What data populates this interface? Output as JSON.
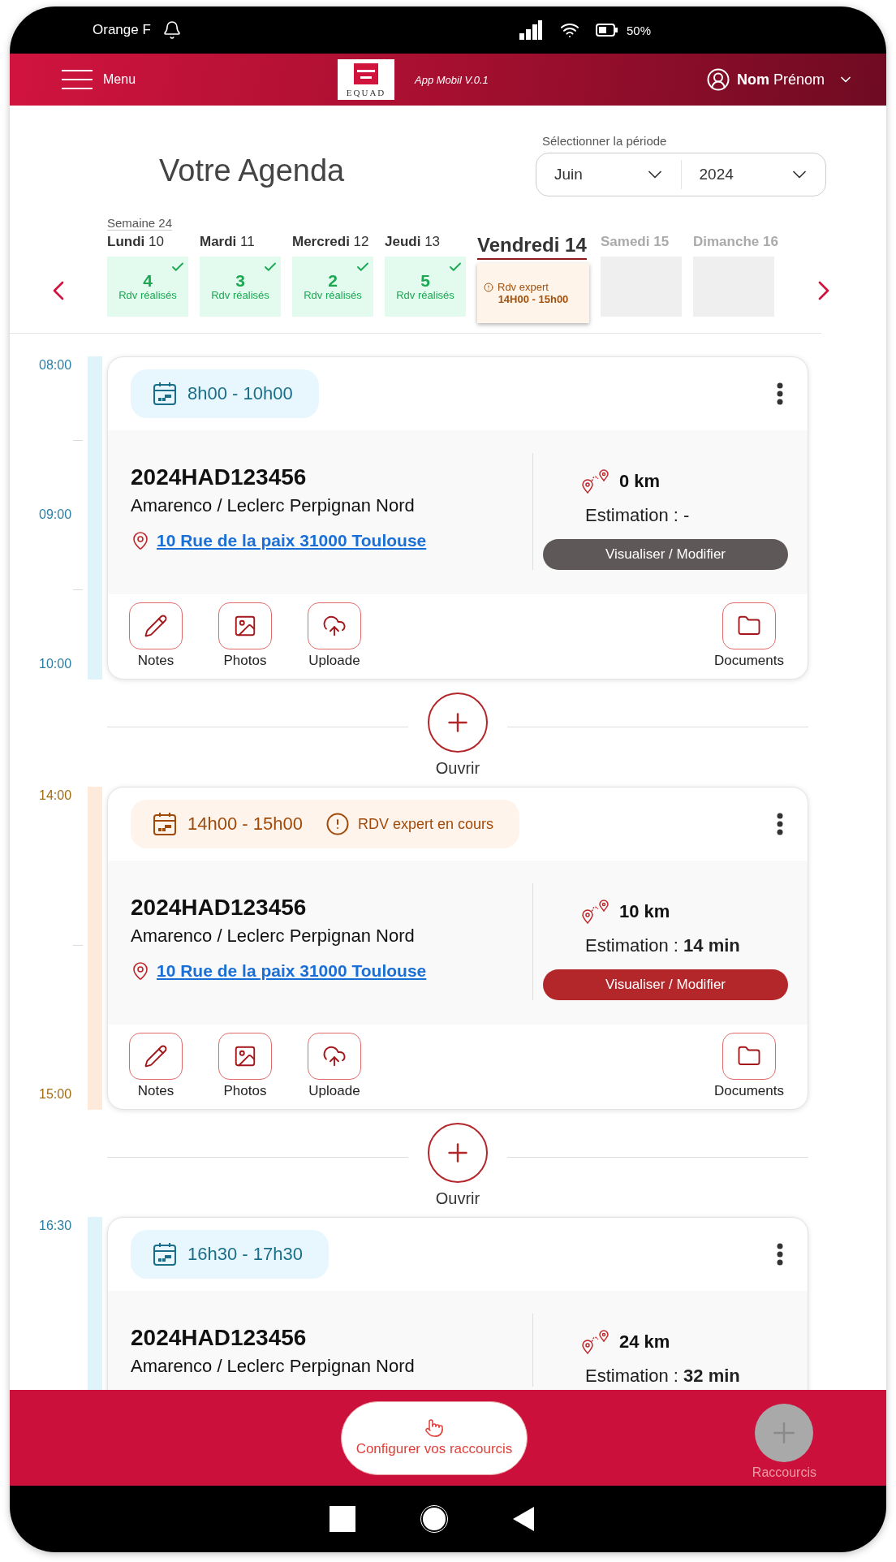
{
  "status_bar": {
    "carrier": "Orange F",
    "battery": "50%"
  },
  "header": {
    "menu_label": "Menu",
    "logo_text": "EQUAD",
    "version": "App Mobil V.0.1",
    "user": "**Nom** Prénom"
  },
  "agenda": {
    "title": "Votre Agenda",
    "period": {
      "label": "Sélectionner la période",
      "month": "Juin",
      "year": "2024"
    }
  },
  "week": {
    "label": "Semaine 24",
    "days": [
      {
        "label": "**Lundi** 10",
        "selected": false,
        "kind": "done",
        "count": "4",
        "caption": "Rdv réalisés"
      },
      {
        "label": "**Mardi** 11",
        "selected": false,
        "kind": "done",
        "count": "3",
        "caption": "Rdv réalisés"
      },
      {
        "label": "**Mercredi** 12",
        "selected": false,
        "kind": "done",
        "count": "2",
        "caption": "Rdv réalisés"
      },
      {
        "label": "**Jeudi** 13",
        "selected": false,
        "kind": "done",
        "count": "5",
        "caption": "Rdv réalisés"
      },
      {
        "label": "Vendredi 14",
        "selected": true,
        "kind": "alert",
        "caption": "Rdv expert",
        "time": "14H00 - 15h00"
      },
      {
        "label": "Samedi 15",
        "selected": false,
        "kind": "empty"
      },
      {
        "label": "Dimanche 16",
        "selected": false,
        "kind": "empty"
      }
    ]
  },
  "timeline": [
    {
      "kind": "appointment",
      "in_progress": false,
      "times": [
        "08:00",
        "09:00",
        "10:00"
      ],
      "slot": "8h00 - 10h00",
      "reference": "2024HAD123456",
      "client": "Amarenco / Leclerc Perpignan Nord",
      "address": "10 Rue de la paix 31000 Toulouse",
      "distance": "0 km",
      "estimate": "Estimation : -",
      "action": "Visualiser / Modifier",
      "tools": [
        {
          "kind": "notes",
          "label": "Notes"
        },
        {
          "kind": "photos",
          "label": "Photos"
        },
        {
          "kind": "upload",
          "label": "Uploade"
        },
        {
          "kind": "documents",
          "label": "Documents"
        }
      ]
    },
    {
      "kind": "add",
      "label": "Ouvrir"
    },
    {
      "kind": "appointment",
      "in_progress": true,
      "times": [
        "14:00",
        "15:00"
      ],
      "slot": "14h00 - 15h00",
      "alert": "RDV expert en cours",
      "reference": "2024HAD123456",
      "client": "Amarenco / Leclerc Perpignan Nord",
      "address": "10 Rue de la paix 31000 Toulouse",
      "distance": "10 km",
      "estimate": "Estimation : **14 min**",
      "action": "Visualiser / Modifier",
      "tools": [
        {
          "kind": "notes",
          "label": "Notes"
        },
        {
          "kind": "photos",
          "label": "Photos"
        },
        {
          "kind": "upload",
          "label": "Uploade"
        },
        {
          "kind": "documents",
          "label": "Documents"
        }
      ]
    },
    {
      "kind": "add",
      "label": "Ouvrir"
    },
    {
      "kind": "appointment",
      "in_progress": false,
      "times": [
        "16:30"
      ],
      "slot": "16h30 - 17h30",
      "reference": "2024HAD123456",
      "client": "Amarenco / Leclerc Perpignan Nord",
      "distance": "24 km",
      "estimate": "Estimation : **32 min**"
    }
  ],
  "bottom_bar": {
    "configure": "Configurer vos raccourcis",
    "shortcuts": "Raccourcis"
  }
}
